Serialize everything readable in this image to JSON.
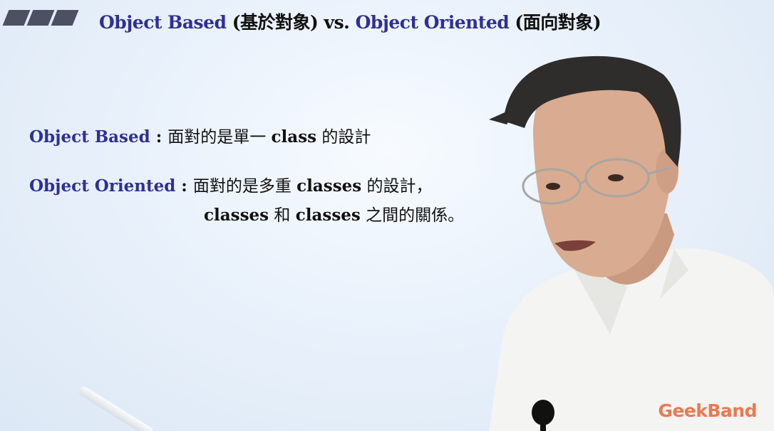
{
  "slide": {
    "title": {
      "part1": "Object Based",
      "part2": " (基於對象) vs. ",
      "part3": "Object Oriented",
      "part4": " (面向對象)"
    },
    "line1": {
      "term": "Object Based",
      "sep": " : ",
      "t1": "面對的是單一 ",
      "t2": "class",
      "t3": " 的設計"
    },
    "line2": {
      "term": "Object Oriented",
      "sep": " : ",
      "t1": "面對的是多重 ",
      "t2": "classes",
      "t3": " 的設計，"
    },
    "line3": {
      "t1": "classes",
      "t2": " 和 ",
      "t3": "classes",
      "t4": " 之間的關係。"
    }
  },
  "logo": "GeekBand",
  "colors": {
    "term_blue": "#2f2f95",
    "logo_orange": "#e87a52",
    "bars": "#4d4f62"
  }
}
